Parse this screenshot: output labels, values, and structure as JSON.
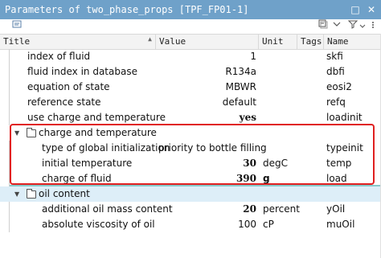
{
  "window": {
    "title": "Parameters of two_phase_props [TPF_FP01-1]",
    "controls": [
      "□",
      "✕"
    ]
  },
  "toolbar": {
    "icons": [
      "properties-icon",
      "collapse-all-icon",
      "expand-icon",
      "filter-icon"
    ]
  },
  "columns": [
    "Title",
    "Value",
    "Unit",
    "Tags",
    "Name"
  ],
  "rows": [
    {
      "title": "index of fluid",
      "value": "1",
      "unit": "",
      "name": "skfi",
      "bold": false
    },
    {
      "title": "fluid index in database",
      "value": "R134a",
      "unit": "",
      "name": "dbfi",
      "bold": false
    },
    {
      "title": "equation of state",
      "value": "MBWR",
      "unit": "",
      "name": "eosi2",
      "bold": false
    },
    {
      "title": "reference state",
      "value": "default",
      "unit": "",
      "name": "refq",
      "bold": false
    },
    {
      "title": "use charge and temperature",
      "value": "yes",
      "unit": "",
      "name": "loadinit",
      "bold": true
    }
  ],
  "groups": [
    {
      "title": "charge and temperature",
      "expanded": true,
      "rows": [
        {
          "title": "type of global initialization",
          "value": "priority to bottle filling",
          "unit": "",
          "name": "typeinit",
          "bold": false
        },
        {
          "title": "initial temperature",
          "value": "30",
          "unit": "degC",
          "name": "temp",
          "bold": true
        },
        {
          "title": "charge of fluid",
          "value": "390",
          "unit": "g",
          "name": "load",
          "bold": true
        }
      ]
    },
    {
      "title": "oil content",
      "expanded": true,
      "rows": [
        {
          "title": "additional oil mass content",
          "value": "20",
          "unit": "percent",
          "name": "yOil",
          "bold": true
        },
        {
          "title": "absolute viscosity of oil",
          "value": "100",
          "unit": "cP",
          "name": "muOil",
          "bold": false
        }
      ]
    }
  ],
  "colors": {
    "titlebar": "#6fa1c9",
    "highlight_border": "#e02020",
    "selected_group": "#ddeef8"
  }
}
